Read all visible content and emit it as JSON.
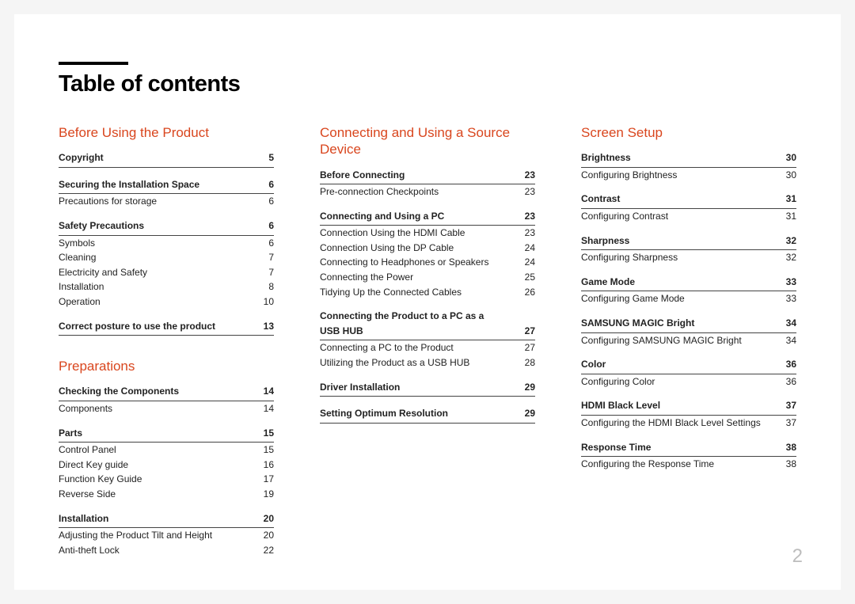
{
  "title": "Table of contents",
  "pageNumber": "2",
  "col1": {
    "chapter1": "Before Using the Product",
    "g1": {
      "h": {
        "t": "Copyright",
        "p": "5"
      }
    },
    "g2": {
      "h": {
        "t": "Securing the Installation Space",
        "p": "6"
      },
      "r1": {
        "t": "Precautions for storage",
        "p": "6"
      }
    },
    "g3": {
      "h": {
        "t": "Safety Precautions",
        "p": "6"
      },
      "r1": {
        "t": "Symbols",
        "p": "6"
      },
      "r2": {
        "t": "Cleaning",
        "p": "7"
      },
      "r3": {
        "t": "Electricity and Safety",
        "p": "7"
      },
      "r4": {
        "t": "Installation",
        "p": "8"
      },
      "r5": {
        "t": "Operation",
        "p": "10"
      }
    },
    "g4": {
      "h": {
        "t": "Correct posture to use the product",
        "p": "13"
      }
    },
    "chapter2": "Preparations",
    "g5": {
      "h": {
        "t": "Checking the Components",
        "p": "14"
      },
      "r1": {
        "t": "Components",
        "p": "14"
      }
    },
    "g6": {
      "h": {
        "t": "Parts",
        "p": "15"
      },
      "r1": {
        "t": "Control Panel",
        "p": "15"
      },
      "r2": {
        "t": "Direct Key guide",
        "p": "16"
      },
      "r3": {
        "t": "Function Key Guide",
        "p": "17"
      },
      "r4": {
        "t": "Reverse Side",
        "p": "19"
      }
    },
    "g7": {
      "h": {
        "t": "Installation",
        "p": "20"
      },
      "r1": {
        "t": "Adjusting the Product Tilt and Height",
        "p": "20"
      },
      "r2": {
        "t": "Anti-theft Lock",
        "p": "22"
      }
    }
  },
  "col2": {
    "chapter1": "Connecting and Using a Source Device",
    "g1": {
      "h": {
        "t": "Before Connecting",
        "p": "23"
      },
      "r1": {
        "t": "Pre-connection Checkpoints",
        "p": "23"
      }
    },
    "g2": {
      "h": {
        "t": "Connecting and Using a PC",
        "p": "23"
      },
      "r1": {
        "t": "Connection Using the HDMI Cable",
        "p": "23"
      },
      "r2": {
        "t": "Connection Using the DP Cable",
        "p": "24"
      },
      "r3": {
        "t": "Connecting to Headphones or Speakers",
        "p": "24"
      },
      "r4": {
        "t": "Connecting the Power",
        "p": "25"
      },
      "r5": {
        "t": "Tidying Up the Connected Cables",
        "p": "26"
      }
    },
    "g3": {
      "h1": {
        "t": "Connecting the Product to a PC as a",
        "p": ""
      },
      "h2": {
        "t": "USB HUB",
        "p": "27"
      },
      "r1": {
        "t": "Connecting a PC to the Product",
        "p": "27"
      },
      "r2": {
        "t": "Utilizing the Product as a USB HUB",
        "p": "28"
      }
    },
    "g4": {
      "h": {
        "t": "Driver Installation",
        "p": "29"
      }
    },
    "g5": {
      "h": {
        "t": "Setting Optimum Resolution",
        "p": "29"
      }
    }
  },
  "col3": {
    "chapter1": "Screen Setup",
    "g1": {
      "h": {
        "t": "Brightness",
        "p": "30"
      },
      "r1": {
        "t": "Configuring Brightness",
        "p": "30"
      }
    },
    "g2": {
      "h": {
        "t": "Contrast",
        "p": "31"
      },
      "r1": {
        "t": "Configuring Contrast",
        "p": "31"
      }
    },
    "g3": {
      "h": {
        "t": "Sharpness",
        "p": "32"
      },
      "r1": {
        "t": "Configuring Sharpness",
        "p": "32"
      }
    },
    "g4": {
      "h": {
        "t": "Game Mode",
        "p": "33"
      },
      "r1": {
        "t": "Configuring Game Mode",
        "p": "33"
      }
    },
    "g5": {
      "h": {
        "t": "SAMSUNG MAGIC Bright",
        "p": "34"
      },
      "r1": {
        "t": "Configuring SAMSUNG MAGIC Bright",
        "p": "34"
      }
    },
    "g6": {
      "h": {
        "t": "Color",
        "p": "36"
      },
      "r1": {
        "t": "Configuring Color",
        "p": "36"
      }
    },
    "g7": {
      "h": {
        "t": "HDMI Black Level",
        "p": "37"
      },
      "r1": {
        "t": "Configuring the HDMI Black Level Settings",
        "p": "37"
      }
    },
    "g8": {
      "h": {
        "t": "Response Time",
        "p": "38"
      },
      "r1": {
        "t": "Configuring the Response Time",
        "p": "38"
      }
    }
  }
}
